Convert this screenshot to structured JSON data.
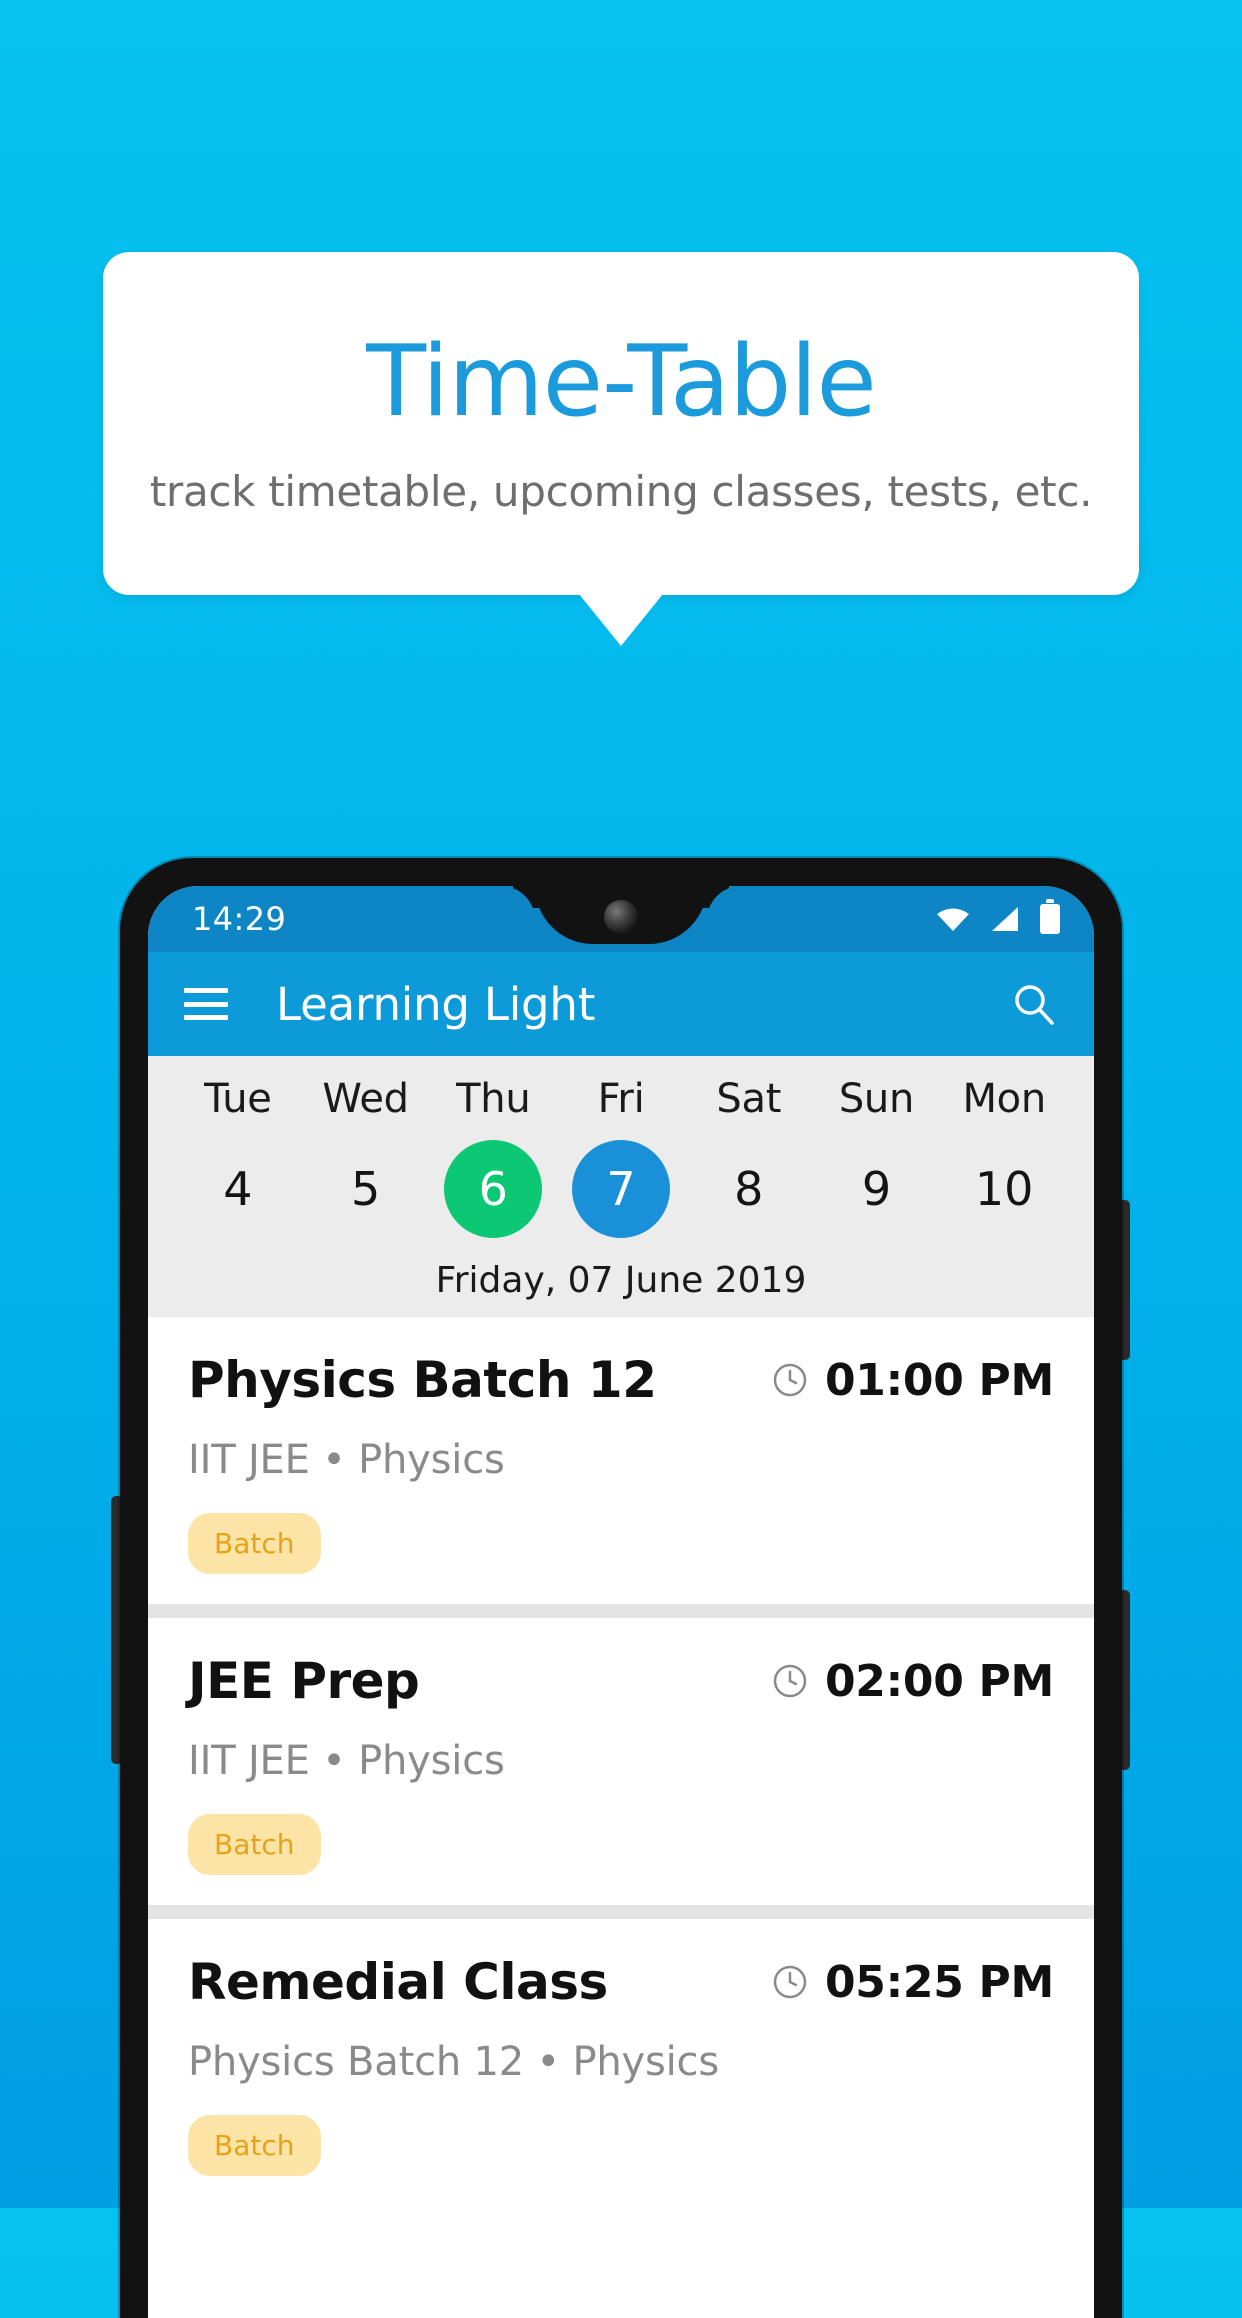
{
  "promo": {
    "title": "Time-Table",
    "subtitle": "track timetable, upcoming classes, tests, etc.",
    "title_color": "#1C9BDC",
    "background_color": "#02B5EC"
  },
  "status_bar": {
    "clock": "14:29",
    "icons": [
      "wifi-icon",
      "signal-icon",
      "battery-icon"
    ]
  },
  "app_bar": {
    "menu_icon": "hamburger-menu-icon",
    "title": "Learning Light",
    "search_icon": "search-icon",
    "color": "#0C9AD8"
  },
  "date_strip": {
    "days": [
      {
        "name": "Tue",
        "number": "4",
        "state": "normal"
      },
      {
        "name": "Wed",
        "number": "5",
        "state": "normal"
      },
      {
        "name": "Thu",
        "number": "6",
        "state": "today"
      },
      {
        "name": "Fri",
        "number": "7",
        "state": "selected"
      },
      {
        "name": "Sat",
        "number": "8",
        "state": "normal"
      },
      {
        "name": "Sun",
        "number": "9",
        "state": "normal"
      },
      {
        "name": "Mon",
        "number": "10",
        "state": "normal"
      }
    ],
    "selected_date_label": "Friday, 07 June 2019",
    "today_color": "#0CC773",
    "selected_color": "#1A90D9"
  },
  "classes": [
    {
      "title": "Physics Batch 12",
      "time": "01:00 PM",
      "subtitle": "IIT JEE • Physics",
      "badge": "Batch"
    },
    {
      "title": "JEE Prep",
      "time": "02:00 PM",
      "subtitle": "IIT JEE • Physics",
      "badge": "Batch"
    },
    {
      "title": "Remedial Class",
      "time": "05:25 PM",
      "subtitle": "Physics Batch 12 • Physics",
      "badge": "Batch"
    }
  ]
}
